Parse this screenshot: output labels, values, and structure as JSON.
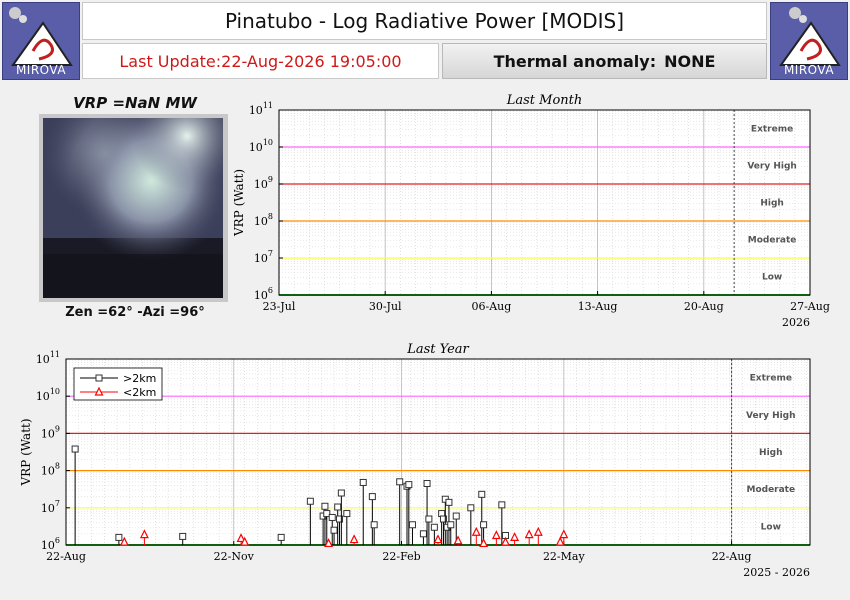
{
  "header": {
    "title": "Pinatubo - Log Radiative Power [MODIS]",
    "last_update": "Last Update:22-Aug-2026 19:05:00",
    "anomaly_label": "Thermal anomaly:",
    "anomaly_value": "NONE",
    "logo_text": "MIROVA"
  },
  "thumbnail": {
    "vrp_label": "VRP =NaN MW",
    "zen_label": "Zen =62° -Azi =96°"
  },
  "colors": {
    "extreme": "#ff66ff",
    "very_high": "#e02020",
    "high": "#ff8c00",
    "moderate": "#ffff33",
    "low": "#22c022",
    "above_2km": "#000000",
    "below_2km": "#ff0000"
  },
  "chart_data": [
    {
      "type": "scatter",
      "title": "Last Month",
      "ylabel": "VRP (Watt)",
      "yscale": "log",
      "ylim": [
        1000000,
        100000000000
      ],
      "y_ticks": [
        {
          "base": "10",
          "exp": "6"
        },
        {
          "base": "10",
          "exp": "7"
        },
        {
          "base": "10",
          "exp": "8"
        },
        {
          "base": "10",
          "exp": "9"
        },
        {
          "base": "10",
          "exp": "10"
        },
        {
          "base": "10",
          "exp": "11"
        }
      ],
      "x_ticks": [
        "23-Jul",
        "30-Jul",
        "06-Aug",
        "13-Aug",
        "20-Aug",
        "27-Aug"
      ],
      "x_year_label": "2026",
      "current_marker": "22-Aug",
      "zones": [
        "Extreme",
        "Very High",
        "High",
        "Moderate",
        "Low"
      ],
      "series": []
    },
    {
      "type": "scatter",
      "title": "Last Year",
      "ylabel": "VRP (Watt)",
      "yscale": "log",
      "ylim": [
        1000000,
        100000000000
      ],
      "y_ticks": [
        {
          "base": "10",
          "exp": "6"
        },
        {
          "base": "10",
          "exp": "7"
        },
        {
          "base": "10",
          "exp": "8"
        },
        {
          "base": "10",
          "exp": "9"
        },
        {
          "base": "10",
          "exp": "10"
        },
        {
          "base": "10",
          "exp": "11"
        }
      ],
      "x_ticks": [
        "22-Aug",
        "22-Nov",
        "22-Feb",
        "22-May",
        "22-Aug"
      ],
      "x_year_label": "2025 - 2026",
      "current_marker": "22-Aug",
      "zones": [
        "Extreme",
        "Very High",
        "High",
        "Moderate",
        "Low"
      ],
      "series": [
        {
          "name": ">2km",
          "marker": "square",
          "points": [
            {
              "x": "2025-08-27",
              "y": 380000000
            },
            {
              "x": "2025-09-20",
              "y": 1600000
            },
            {
              "x": "2025-10-25",
              "y": 1700000
            },
            {
              "x": "2025-12-18",
              "y": 1600000
            },
            {
              "x": "2026-01-03",
              "y": 15000000
            },
            {
              "x": "2026-01-10",
              "y": 6000000
            },
            {
              "x": "2026-01-11",
              "y": 11000000
            },
            {
              "x": "2026-01-12",
              "y": 7000000
            },
            {
              "x": "2026-01-15",
              "y": 5500000
            },
            {
              "x": "2026-01-16",
              "y": 2500000
            },
            {
              "x": "2026-01-18",
              "y": 10500000
            },
            {
              "x": "2026-01-19",
              "y": 5000000
            },
            {
              "x": "2026-01-20",
              "y": 25000000
            },
            {
              "x": "2026-01-23",
              "y": 7000000
            },
            {
              "x": "2026-02-01",
              "y": 48000000
            },
            {
              "x": "2026-02-06",
              "y": 20000000
            },
            {
              "x": "2026-02-07",
              "y": 3500000
            },
            {
              "x": "2026-02-21",
              "y": 50000000
            },
            {
              "x": "2026-02-25",
              "y": 38000000
            },
            {
              "x": "2026-02-26",
              "y": 42000000
            },
            {
              "x": "2026-02-28",
              "y": 3500000
            },
            {
              "x": "2026-03-06",
              "y": 2000000
            },
            {
              "x": "2026-03-08",
              "y": 45000000
            },
            {
              "x": "2026-03-09",
              "y": 5000000
            },
            {
              "x": "2026-03-12",
              "y": 3000000
            },
            {
              "x": "2026-03-16",
              "y": 7000000
            },
            {
              "x": "2026-03-17",
              "y": 5000000
            },
            {
              "x": "2026-03-18",
              "y": 17000000
            },
            {
              "x": "2026-03-19",
              "y": 3000000
            },
            {
              "x": "2026-03-20",
              "y": 14000000
            },
            {
              "x": "2026-03-21",
              "y": 3500000
            },
            {
              "x": "2026-03-24",
              "y": 6000000
            },
            {
              "x": "2026-04-01",
              "y": 10000000
            },
            {
              "x": "2026-04-07",
              "y": 23000000
            },
            {
              "x": "2026-04-08",
              "y": 3500000
            },
            {
              "x": "2026-04-18",
              "y": 12000000
            },
            {
              "x": "2026-04-20",
              "y": 1800000
            }
          ]
        },
        {
          "name": "<2km",
          "marker": "triangle",
          "points": [
            {
              "x": "2025-09-23",
              "y": 1200000
            },
            {
              "x": "2025-10-04",
              "y": 1900000
            },
            {
              "x": "2025-11-26",
              "y": 1500000
            },
            {
              "x": "2025-11-28",
              "y": 1200000
            },
            {
              "x": "2026-01-13",
              "y": 1100000
            },
            {
              "x": "2026-01-27",
              "y": 1400000
            },
            {
              "x": "2026-03-14",
              "y": 1400000
            },
            {
              "x": "2026-03-25",
              "y": 1300000
            },
            {
              "x": "2026-04-04",
              "y": 2200000
            },
            {
              "x": "2026-04-08",
              "y": 1100000
            },
            {
              "x": "2026-04-15",
              "y": 1800000
            },
            {
              "x": "2026-04-20",
              "y": 1200000
            },
            {
              "x": "2026-04-25",
              "y": 1600000
            },
            {
              "x": "2026-05-03",
              "y": 1900000
            },
            {
              "x": "2026-05-08",
              "y": 2200000
            },
            {
              "x": "2026-05-20",
              "y": 1200000
            },
            {
              "x": "2026-05-22",
              "y": 1900000
            }
          ]
        }
      ]
    }
  ]
}
